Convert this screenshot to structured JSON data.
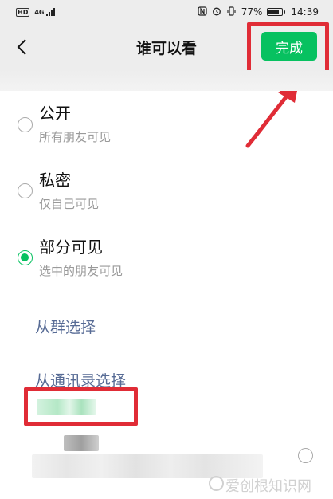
{
  "status_bar": {
    "hd": "HD",
    "network": "4G",
    "battery_percent": "77%",
    "time": "14:39"
  },
  "nav": {
    "title": "谁可以看",
    "done_label": "完成"
  },
  "options": [
    {
      "title": "公开",
      "subtitle": "所有朋友可见",
      "selected": false
    },
    {
      "title": "私密",
      "subtitle": "仅自己可见",
      "selected": false
    },
    {
      "title": "部分可见",
      "subtitle": "选中的朋友可见",
      "selected": true
    }
  ],
  "select_links": {
    "from_group": "从群选择",
    "from_contacts": "从通讯录选择"
  },
  "watermark": "爱创根知识网",
  "colors": {
    "accent": "#07c160",
    "link": "#576b95",
    "highlight": "#e02c36"
  }
}
